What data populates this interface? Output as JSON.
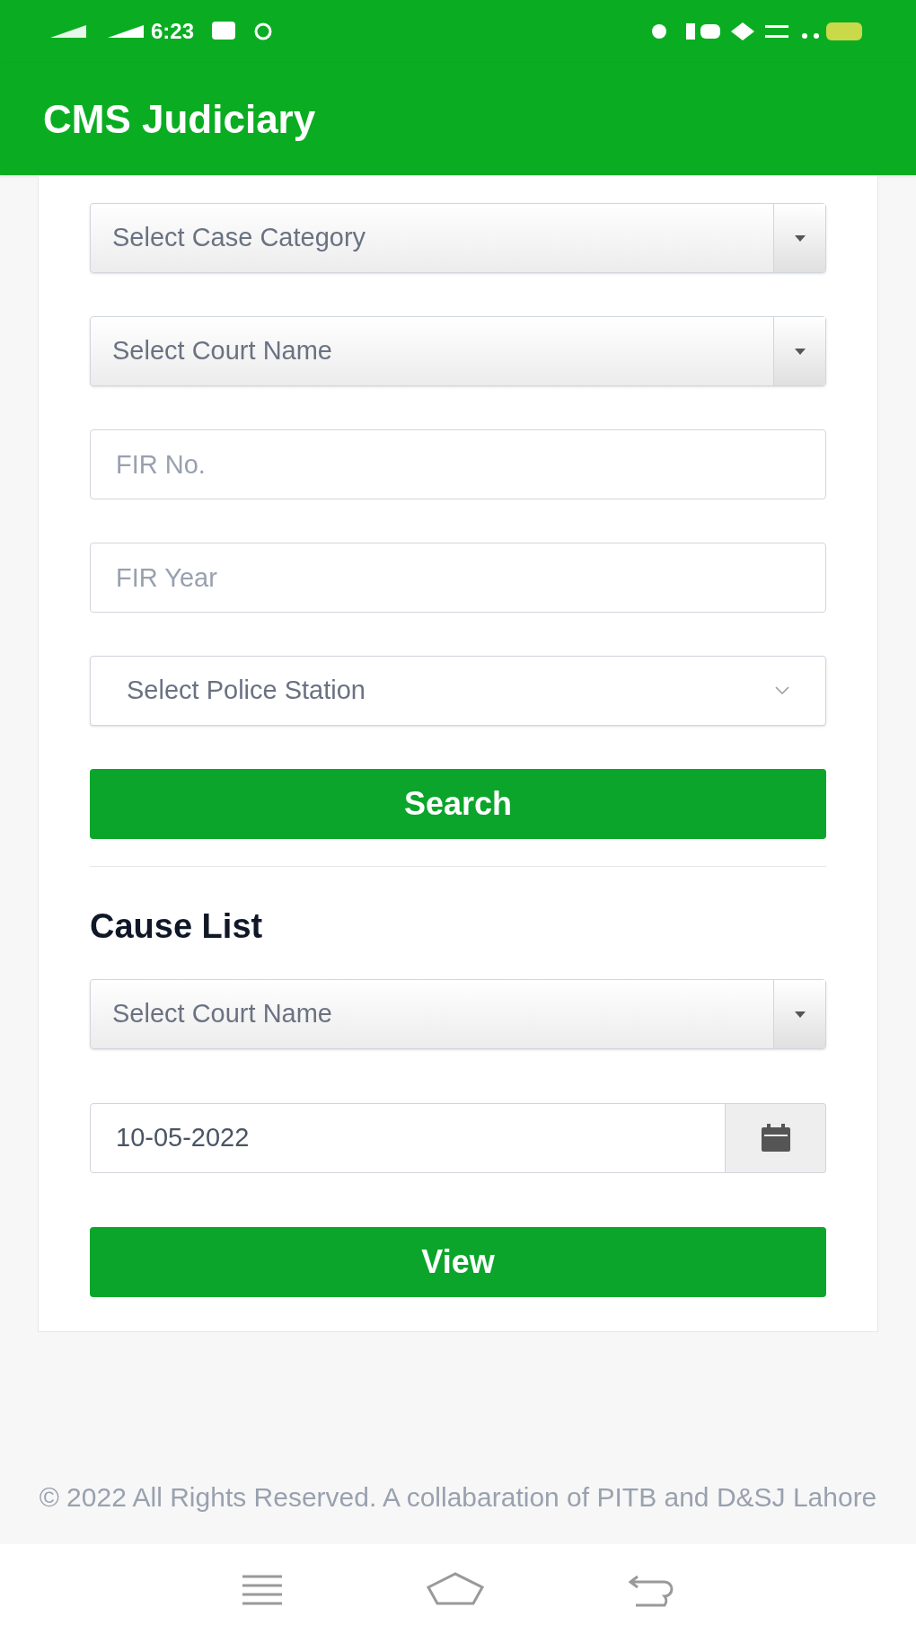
{
  "status_bar": {
    "time": "6:23"
  },
  "app_bar": {
    "title": "CMS Judiciary"
  },
  "case_search": {
    "fields": [
      {
        "kind": "dropdown",
        "placeholder": "Select Case Category"
      },
      {
        "kind": "dropdown",
        "placeholder": "Select Court Name"
      },
      {
        "kind": "input",
        "placeholder": "FIR No."
      },
      {
        "kind": "input",
        "placeholder": "FIR Year"
      },
      {
        "kind": "select",
        "placeholder": "Select Police Station"
      }
    ],
    "button": "Search"
  },
  "cause_list": {
    "title": "Cause List",
    "fields": [
      {
        "kind": "dropdown",
        "placeholder": "Select Court Name"
      },
      {
        "kind": "date",
        "value": "10-05-2022"
      }
    ],
    "button": "View"
  },
  "footer": {
    "text": "© 2022 All Rights Reserved. A collabaration of PITB and D&SJ Lahore"
  }
}
